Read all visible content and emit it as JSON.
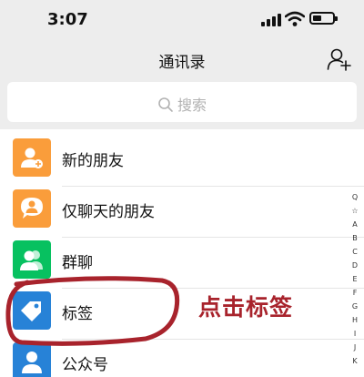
{
  "status_bar": {
    "time": "3:07"
  },
  "header": {
    "title": "通讯录",
    "add_contact_icon": "add-contact-icon"
  },
  "search": {
    "placeholder": "搜索",
    "icon": "search-icon"
  },
  "contacts_list": {
    "items": [
      {
        "label": "新的朋友",
        "icon": "add-friend-icon",
        "color": "#fa9d3b"
      },
      {
        "label": "仅聊天的朋友",
        "icon": "chat-only-friend-icon",
        "color": "#fa9d3b"
      },
      {
        "label": "群聊",
        "icon": "group-chat-icon",
        "color": "#07c160"
      },
      {
        "label": "标签",
        "icon": "tag-icon",
        "color": "#2782d7"
      },
      {
        "label": "公众号",
        "icon": "official-account-icon",
        "color": "#2782d7"
      }
    ]
  },
  "index_bar": [
    "Q",
    "☆",
    "A",
    "B",
    "C",
    "D",
    "E",
    "F",
    "G",
    "H",
    "I",
    "J",
    "K"
  ],
  "annotation": {
    "text": "点击标签",
    "color": "#a8232c"
  }
}
